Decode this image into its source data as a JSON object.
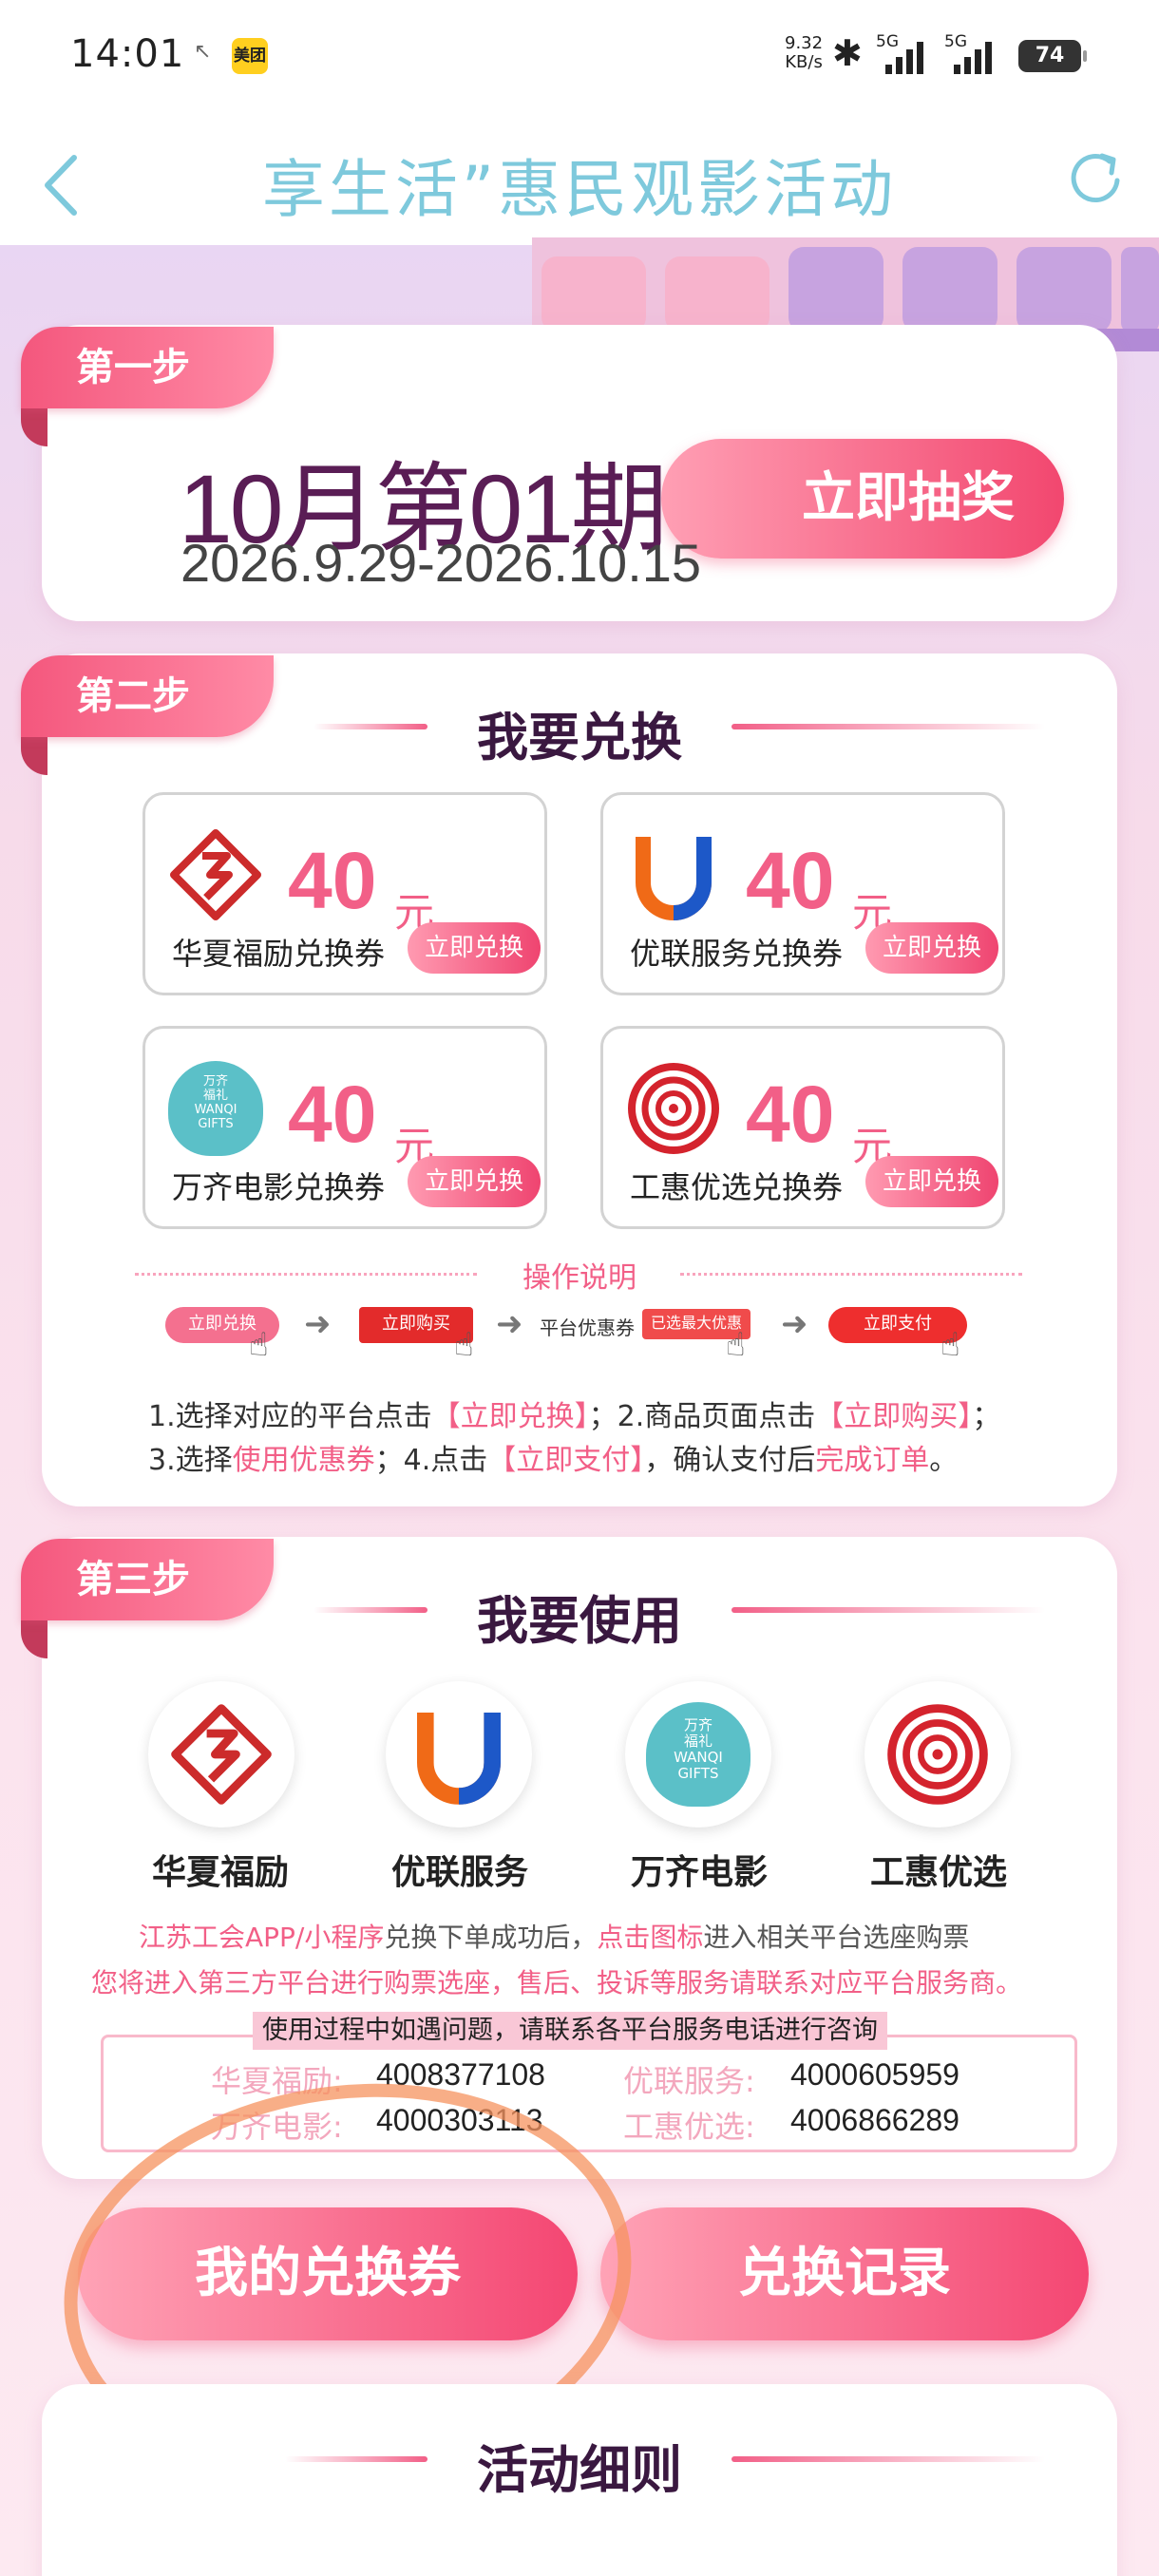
{
  "status_bar": {
    "time": "14:01",
    "app_badge": "美团",
    "speed_value": "9.32",
    "speed_unit": "KB/s",
    "net1": "5G",
    "net2": "5G",
    "battery": "74"
  },
  "header": {
    "title": "享生活”惠民观影活动"
  },
  "step1": {
    "tag": "第一步",
    "period": "10月第01期",
    "dates": "2026.9.29-2026.10.15",
    "lottery_button": "立即抽奖"
  },
  "step2": {
    "tag": "第二步",
    "title": "我要兑换",
    "coupons": [
      {
        "amount": "40",
        "unit": "元",
        "name": "华夏福励兑换券",
        "button": "立即兑换"
      },
      {
        "amount": "40",
        "unit": "元",
        "name": "优联服务兑换券",
        "button": "立即兑换"
      },
      {
        "amount": "40",
        "unit": "元",
        "name": "万齐电影兑换券",
        "button": "立即兑换"
      },
      {
        "amount": "40",
        "unit": "元",
        "name": "工惠优选兑换券",
        "button": "立即兑换"
      }
    ],
    "wanqi_logo": {
      "line1": "万齐",
      "line2": "福礼",
      "line3": "WANQI",
      "line4": "GIFTS"
    },
    "instructions_title": "操作说明",
    "flow": {
      "step1": "立即兑换",
      "step2": "立即购买",
      "step3_label": "平台优惠券",
      "step3_tag": "已选最大优惠",
      "step4": "立即支付"
    },
    "line1": {
      "a": "1.选择对应的平台点击",
      "b": "【立即兑换】",
      "c": "；2.商品页面点击",
      "d": "【立即购买】",
      "e": "；"
    },
    "line2": {
      "a": "3.选择",
      "b": "使用优惠券",
      "c": "；4.点击",
      "d": "【立即支付】",
      "e": "，确认支付后",
      "f": "完成订单",
      "g": "。"
    }
  },
  "step3": {
    "tag": "第三步",
    "title": "我要使用",
    "platforms": [
      {
        "label": "华夏福励"
      },
      {
        "label": "优联服务"
      },
      {
        "label": "万齐电影"
      },
      {
        "label": "工惠优选"
      }
    ],
    "note1": {
      "a": "江苏工会APP/小程序",
      "b": "兑换下单成功后，",
      "c": "点击图标",
      "d": "进入相关平台选座购票"
    },
    "note2": "您将进入第三方平台进行购票选座，售后、投诉等服务请联系对应平台服务商。",
    "contact_head": "使用过程中如遇问题，请联系各平台服务电话进行咨询",
    "contacts": [
      {
        "name": "华夏福励:",
        "phone": "4008377108"
      },
      {
        "name": "优联服务:",
        "phone": "4000605959"
      },
      {
        "name": "万齐电影:",
        "phone": "4000303113"
      },
      {
        "name": "工惠优选:",
        "phone": "4006866289"
      }
    ]
  },
  "buttons": {
    "my_coupons": "我的兑换券",
    "history": "兑换记录"
  },
  "rules": {
    "title": "活动细则"
  },
  "colors": {
    "accent": "#f25f87",
    "title": "#7ec9dc",
    "highlight_circle": "#f5935f"
  }
}
